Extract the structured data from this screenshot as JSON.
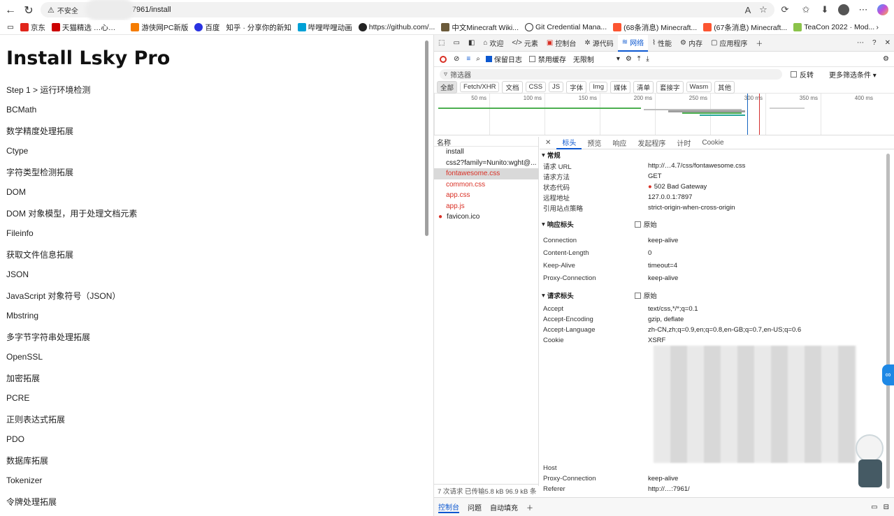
{
  "browser": {
    "security_label": "不安全",
    "url": ":7961/install",
    "bookmarks": [
      "京东",
      "天猫精选 …心…",
      "游侠网PC新版",
      "百度",
      "知乎 · 分享你的新知",
      "哔哩哔哩动画",
      "https://github.com/...",
      "中文Minecraft Wiki...",
      "Git Credential Mana...",
      "(68条消息) Minecraft...",
      "(67条消息) Minecraft...",
      "TeaCon 2022 · Mod..."
    ]
  },
  "page": {
    "title": "Install Lsky Pro",
    "items": [
      "Step 1 > 运行环境检测",
      "BCMath",
      "数学精度处理拓展",
      "Ctype",
      "字符类型检测拓展",
      "DOM",
      "DOM 对象模型，用于处理文档元素",
      "Fileinfo",
      "获取文件信息拓展",
      "JSON",
      "JavaScript 对象符号（JSON）",
      "Mbstring",
      "多字节字符串处理拓展",
      "OpenSSL",
      "加密拓展",
      "PCRE",
      "正则表达式拓展",
      "PDO",
      "数据库拓展",
      "Tokenizer",
      "令牌处理拓展"
    ]
  },
  "devtools": {
    "tabs": [
      "欢迎",
      "元素",
      "控制台",
      "源代码",
      "网络",
      "性能",
      "内存",
      "应用程序"
    ],
    "toolbar": {
      "preserve_log": "保留日志",
      "disable_cache": "禁用缓存",
      "throttle": "无限制"
    },
    "filter": {
      "placeholder": "筛选器",
      "invert": "反转",
      "more": "更多筛选条件"
    },
    "types": [
      "全部",
      "Fetch/XHR",
      "文档",
      "CSS",
      "JS",
      "字体",
      "Img",
      "媒体",
      "清单",
      "套接字",
      "Wasm",
      "其他"
    ],
    "timeline_ticks": [
      "50 ms",
      "100 ms",
      "150 ms",
      "200 ms",
      "250 ms",
      "300 ms",
      "350 ms",
      "400 ms"
    ],
    "requests_header": "名称",
    "requests": [
      "install",
      "css2?family=Nunito:wght@...",
      "fontawesome.css",
      "common.css",
      "app.css",
      "app.js",
      "favicon.ico"
    ],
    "detail_tabs": [
      "标头",
      "预览",
      "响应",
      "发起程序",
      "计时",
      "Cookie"
    ],
    "general": {
      "title": "常规",
      "rows": [
        {
          "k": "请求 URL",
          "v": "http://…4.7/css/fontawesome.css"
        },
        {
          "k": "请求方法",
          "v": "GET"
        },
        {
          "k": "状态代码",
          "v": "502 Bad Gateway"
        },
        {
          "k": "远程地址",
          "v": "127.0.0.1:7897"
        },
        {
          "k": "引用站点策略",
          "v": "strict-origin-when-cross-origin"
        }
      ]
    },
    "response_headers": {
      "title": "响应标头",
      "raw": "原始",
      "rows": [
        {
          "k": "Connection",
          "v": "keep-alive"
        },
        {
          "k": "Content-Length",
          "v": "0"
        },
        {
          "k": "Keep-Alive",
          "v": "timeout=4"
        },
        {
          "k": "Proxy-Connection",
          "v": "keep-alive"
        }
      ]
    },
    "request_headers": {
      "title": "请求标头",
      "raw": "原始",
      "rows": [
        {
          "k": "Accept",
          "v": "text/css,*/*;q=0.1"
        },
        {
          "k": "Accept-Encoding",
          "v": "gzip, deflate"
        },
        {
          "k": "Accept-Language",
          "v": "zh-CN,zh;q=0.9,en;q=0.8,en-GB;q=0.7,en-US;q=0.6"
        },
        {
          "k": "Cookie",
          "v": "XSRF"
        },
        {
          "k": "Host",
          "v": ""
        },
        {
          "k": "Proxy-Connection",
          "v": "keep-alive"
        },
        {
          "k": "Referer",
          "v": "http://…:7961/"
        }
      ]
    },
    "status_bar": "7 次请求  已传输5.8 kB  96.9 kB 条",
    "bottom_tabs": [
      "控制台",
      "问题",
      "自动填充"
    ]
  }
}
